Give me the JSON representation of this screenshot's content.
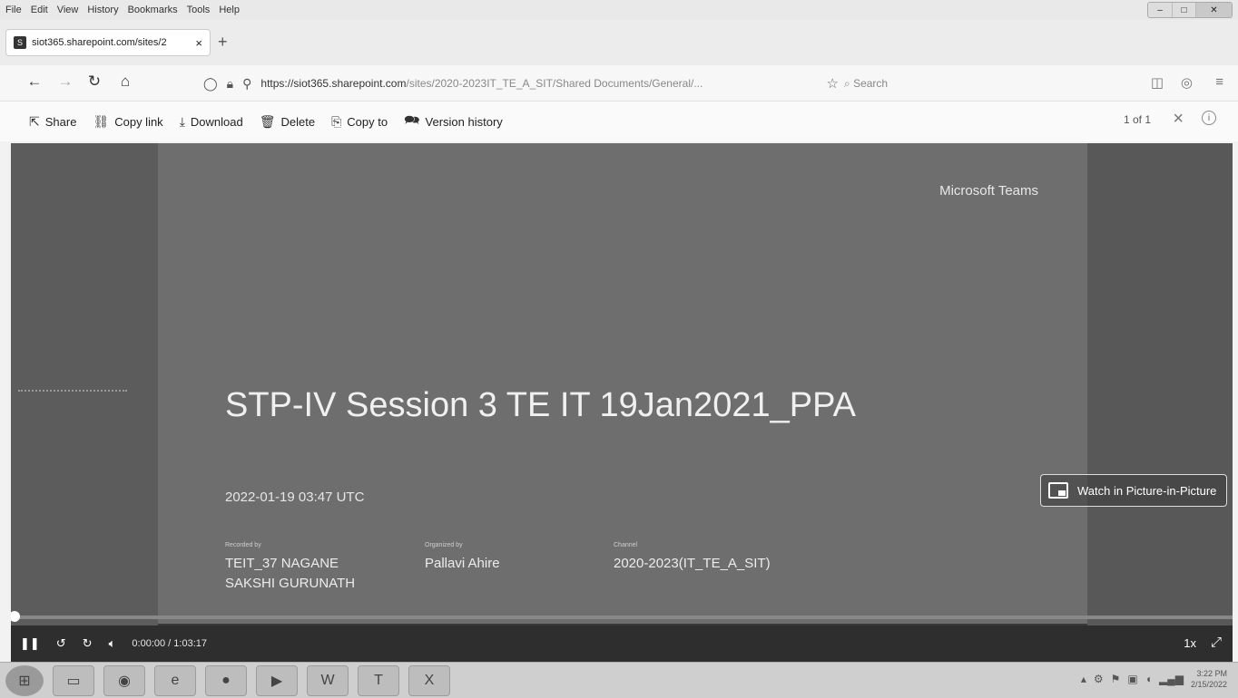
{
  "menu": [
    "File",
    "Edit",
    "View",
    "History",
    "Bookmarks",
    "Tools",
    "Help"
  ],
  "tab": {
    "title": "siot365.sharepoint.com/sites/2",
    "close": "×"
  },
  "newtab": "+",
  "nav": {
    "url_host": "https://siot365.sharepoint.com",
    "url_path": "/sites/2020-2023IT_TE_A_SIT/Shared Documents/General/...",
    "search_placeholder": "Search"
  },
  "commands": [
    {
      "label": "Share",
      "icon": "share-icon"
    },
    {
      "label": "Copy link",
      "icon": "link-icon"
    },
    {
      "label": "Download",
      "icon": "download-icon"
    },
    {
      "label": "Delete",
      "icon": "delete-icon"
    },
    {
      "label": "Copy to",
      "icon": "copy-icon"
    },
    {
      "label": "Version history",
      "icon": "history-icon"
    }
  ],
  "pager": "1 of 1",
  "video": {
    "brand": "Microsoft Teams",
    "title": "STP-IV Session 3 TE IT 19Jan2021_PPA",
    "date": "2022-01-19 03:47 UTC",
    "recorded_by_label": "Recorded by",
    "recorded_by": [
      "TEIT_37 NAGANE",
      "SAKSHI GURUNATH"
    ],
    "organized_by_label": "Organized by",
    "organized_by": "Pallavi  Ahire",
    "channel_label": "Channel",
    "channel": "2020-2023(IT_TE_A_SIT)",
    "pip_label": "Watch in Picture-in-Picture",
    "time_current": "0:00:00",
    "time_total": "1:03:17",
    "progress_fraction": 0.0,
    "speed": "1x"
  },
  "taskbar": {
    "time": "3:22 PM",
    "date": "2/15/2022"
  }
}
